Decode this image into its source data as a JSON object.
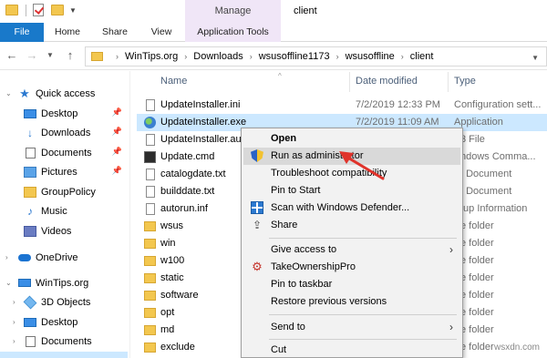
{
  "titlebar": {
    "manage_label": "Manage",
    "window_title": "client"
  },
  "ribbon": {
    "tabs": [
      "File",
      "Home",
      "Share",
      "View",
      "Application Tools"
    ]
  },
  "address": {
    "crumbs": [
      "WinTips.org",
      "Downloads",
      "wsusoffline1173",
      "wsusoffline",
      "client"
    ]
  },
  "navpane": {
    "items": [
      {
        "label": "Quick access",
        "icon": "star-icon"
      },
      {
        "label": "Desktop",
        "icon": "desktop-icon",
        "pinned": true
      },
      {
        "label": "Downloads",
        "icon": "download-icon",
        "pinned": true
      },
      {
        "label": "Documents",
        "icon": "documents-icon",
        "pinned": true
      },
      {
        "label": "Pictures",
        "icon": "pictures-icon",
        "pinned": true
      },
      {
        "label": "GroupPolicy",
        "icon": "folder-icon"
      },
      {
        "label": "Music",
        "icon": "music-icon"
      },
      {
        "label": "Videos",
        "icon": "videos-icon"
      },
      {
        "label": "OneDrive",
        "icon": "onedrive-icon"
      },
      {
        "label": "WinTips.org",
        "icon": "computer-icon"
      },
      {
        "label": "3D Objects",
        "icon": "3d-objects-icon"
      },
      {
        "label": "Desktop",
        "icon": "desktop-icon"
      },
      {
        "label": "Documents",
        "icon": "documents-icon"
      }
    ]
  },
  "filelist": {
    "columns": [
      "Name",
      "Date modified",
      "Type"
    ],
    "rows": [
      {
        "name": "UpdateInstaller.ini",
        "date": "7/2/2019 12:33 PM",
        "type": "Configuration sett..."
      },
      {
        "name": "UpdateInstaller.exe",
        "date": "7/2/2019 11:09 AM",
        "type": "Application"
      },
      {
        "name": "UpdateInstaller.au3",
        "date": "",
        "type": "3 File"
      },
      {
        "name": "Update.cmd",
        "date": "",
        "type": "ndows Comma..."
      },
      {
        "name": "catalogdate.txt",
        "date": "",
        "type": "t Document"
      },
      {
        "name": "builddate.txt",
        "date": "",
        "type": "t Document"
      },
      {
        "name": "autorun.inf",
        "date": "",
        "type": "tup Information"
      },
      {
        "name": "wsus",
        "date": "",
        "type": "e folder"
      },
      {
        "name": "win",
        "date": "",
        "type": "e folder"
      },
      {
        "name": "w100",
        "date": "",
        "type": "e folder"
      },
      {
        "name": "static",
        "date": "",
        "type": "e folder"
      },
      {
        "name": "software",
        "date": "",
        "type": "e folder"
      },
      {
        "name": "opt",
        "date": "",
        "type": "e folder"
      },
      {
        "name": "md",
        "date": "",
        "type": "e folder"
      },
      {
        "name": "exclude",
        "date": "",
        "type": "e folder"
      }
    ]
  },
  "context_menu": {
    "items": [
      "Open",
      "Run as administrator",
      "Troubleshoot compatibility",
      "Pin to Start",
      "Scan with Windows Defender...",
      "Share",
      "Give access to",
      "TakeOwnershipPro",
      "Pin to taskbar",
      "Restore previous versions",
      "Send to",
      "Cut"
    ]
  },
  "watermark": "wsxdn.com",
  "colors": {
    "file_tab": "#1979ca",
    "manage_tab": "#f0e6f7",
    "selection": "#cce8ff",
    "arrow": "#e0332b"
  }
}
